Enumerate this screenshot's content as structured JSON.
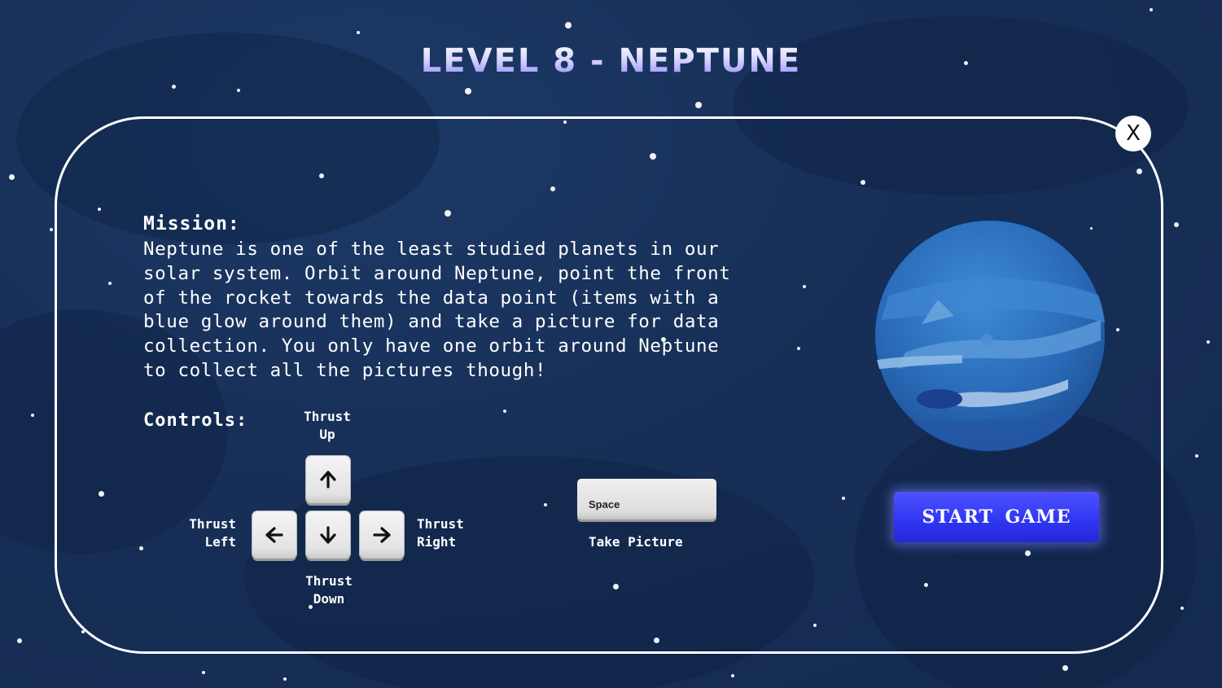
{
  "level_title": "LEVEL 8 - NEPTUNE",
  "close_button": {
    "label": "X"
  },
  "mission": {
    "heading": "Mission:",
    "text": "Neptune is one of the least studied planets in our\nsolar system. Orbit around Neptune, point the front\nof the rocket towards the data point (items with a\nblue glow around them) and take a picture for data\ncollection. You only have one orbit around Neptune\nto collect all the pictures though!"
  },
  "controls": {
    "heading": "Controls:",
    "thrust_up": "Thrust\nUp",
    "thrust_left": "Thrust\nLeft",
    "thrust_right": "Thrust\nRight",
    "thrust_down": "Thrust\nDown",
    "keys": {
      "up_icon": "arrow-up-icon",
      "left_icon": "arrow-left-icon",
      "down_icon": "arrow-down-icon",
      "right_icon": "arrow-right-icon"
    },
    "space_key_label": "Space",
    "take_picture_label": "Take Picture"
  },
  "start_button": {
    "label": "START GAME"
  },
  "planet": {
    "icon": "neptune-planet-icon"
  },
  "colors": {
    "background": "#17315a",
    "panel_border": "#ffffff",
    "start_button": "#2f35f2",
    "planet": "#2a6bb8"
  }
}
